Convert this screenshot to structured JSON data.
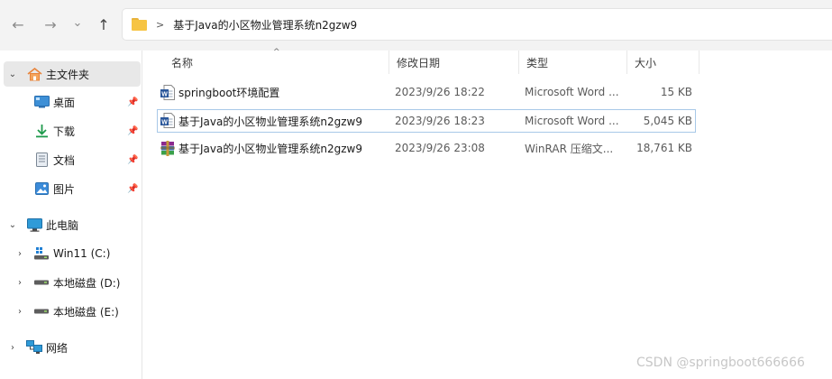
{
  "address": {
    "path": "基于Java的小区物业管理系统n2gzw9"
  },
  "nav": {
    "back": "←",
    "forward": "→",
    "recent": "⌄",
    "up": "↑"
  },
  "sidebar": {
    "home": "主文件夹",
    "quick": [
      {
        "label": "桌面",
        "icon": "desktop-icon"
      },
      {
        "label": "下载",
        "icon": "download-icon"
      },
      {
        "label": "文档",
        "icon": "document-icon"
      },
      {
        "label": "图片",
        "icon": "picture-icon"
      }
    ],
    "pc": "此电脑",
    "drives": [
      "Win11 (C:)",
      "本地磁盘 (D:)",
      "本地磁盘 (E:)"
    ],
    "network": "网络"
  },
  "columns": {
    "name": "名称",
    "date": "修改日期",
    "type": "类型",
    "size": "大小"
  },
  "files": [
    {
      "name": "springboot环境配置",
      "date": "2023/9/26 18:22",
      "type": "Microsoft Word ...",
      "size": "15 KB",
      "icon": "word-doc-icon"
    },
    {
      "name": "基于Java的小区物业管理系统n2gzw9",
      "date": "2023/9/26 18:23",
      "type": "Microsoft Word ...",
      "size": "5,045 KB",
      "icon": "word-doc-icon"
    },
    {
      "name": "基于Java的小区物业管理系统n2gzw9",
      "date": "2023/9/26 23:08",
      "type": "WinRAR 压缩文...",
      "size": "18,761 KB",
      "icon": "winrar-archive-icon"
    }
  ],
  "watermark": "CSDN @springboot666666",
  "colors": {
    "folder": "#f6c443",
    "word_blue": "#2b579a",
    "selection_border": "#a8c8e8",
    "home_orange": "#e8833a"
  }
}
